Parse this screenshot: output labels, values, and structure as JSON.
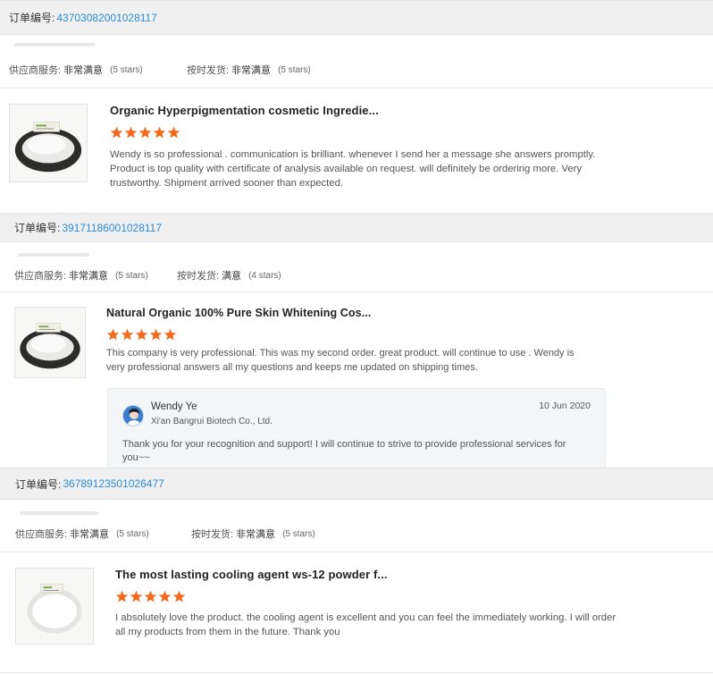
{
  "orders": [
    {
      "order_label": "订单编号:",
      "order_number": "43703082001028117",
      "supplier_service_label": "供应商服务:",
      "supplier_service_value": "非常满意",
      "supplier_service_stars": "(5 stars)",
      "on_time_label": "按时发货:",
      "on_time_value": "非常满意",
      "on_time_stars": "(5 stars)",
      "product_title": "Organic Hyperpigmentation cosmetic Ingredie...",
      "rating": 5,
      "review_text": "Wendy is so professional . communication is brilliant.  whenever I send her a message she answers promptly.  Product is top quality with certificate of analysis available on request. will definitely be ordering more. Very trustworthy.  Shipment arrived sooner than expected."
    },
    {
      "order_label": "订单编号:",
      "order_number": "39171186001028117",
      "supplier_service_label": "供应商服务:",
      "supplier_service_value": "非常满意",
      "supplier_service_stars": "(5 stars)",
      "on_time_label": "按时发货:",
      "on_time_value": "满意",
      "on_time_stars": "(4 stars)",
      "product_title": "Natural Organic 100% Pure Skin Whitening Cos...",
      "rating": 5,
      "review_text": "This company is very professional.  This was my second order. great product.  will continue to use . Wendy is very professional answers all my questions and keeps me updated on shipping times.",
      "reply": {
        "name": "Wendy Ye",
        "company": "Xi'an Bangrui Biotech Co., Ltd.",
        "date": "10 Jun 2020",
        "text": "Thank you for your recognition and support! I will continue to strive to provide professional services for you~~"
      }
    },
    {
      "order_label": "订单编号:",
      "order_number": "36789123501026477",
      "supplier_service_label": "供应商服务:",
      "supplier_service_value": "非常满意",
      "supplier_service_stars": "(5 stars)",
      "on_time_label": "按时发货:",
      "on_time_value": "非常满意",
      "on_time_stars": "(5 stars)",
      "product_title": "The most lasting cooling agent ws-12 powder f...",
      "rating": 5,
      "review_text": "I absolutely love the product. the cooling agent is excellent and you can feel the immediately working. I will order all my products from them in the future. Thank you"
    }
  ],
  "colors": {
    "star": "#f26a1b",
    "order_number": "#2a8bd8",
    "header_bg": "#f0f0f0"
  }
}
